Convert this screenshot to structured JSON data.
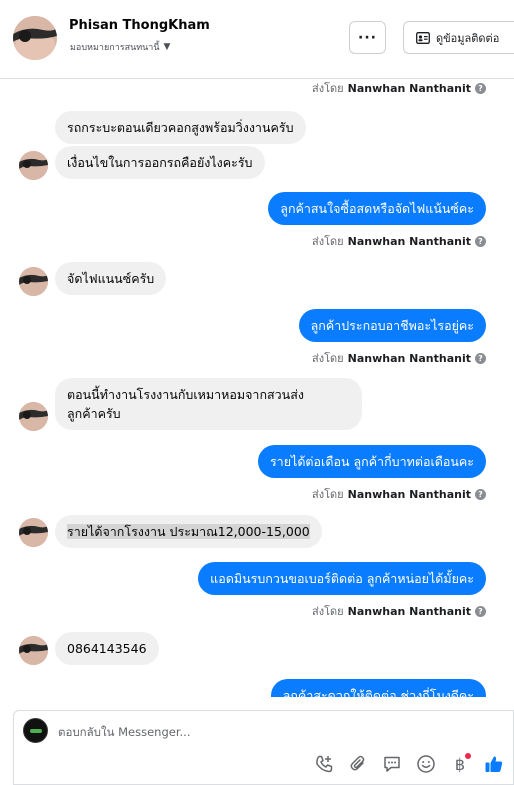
{
  "header": {
    "name": "Phisan ThongKham",
    "assign_label": "มอบหมายการสนทนานี้",
    "more_label": "···",
    "contact_label": "ดูข้อมูลติดต่อ"
  },
  "sent_by": {
    "prefix": "ส่งโดย",
    "author": "Nanwhan Nanthanit",
    "info": "?"
  },
  "messages": [
    "รถกระบะตอนเดียวคอกสูงพร้อมวิ่งงานครับ",
    "เงื่อนไขในการออกรถคือยังไงคะรับ",
    "ลูกค้าสนใจซื้อสดหรือจัดไฟแน้นซ์คะ",
    "จัดไฟแนนซ์ครับ",
    "ลูกค้าประกอบอาชีพอะไรอยู่คะ",
    "ตอนนี้ทำงานโรงงานกับเหมาหอมจากสวนส่ง",
    "ลูกค้าครับ",
    "รายได้ต่อเดือน ลูกค้ากี่บาทต่อเดือนคะ",
    "รายได้จากโรงงาน ประมาณ12,000-15,000",
    "แอดมินรบกวนขอเบอร์ติดต่อ ลูกค้าหน่อยได้มั้ยคะ",
    "0864143546",
    "ลูกค้าสะดวกให้ติดต่อ ช่วงกี่โมงดีคะ"
  ],
  "composer": {
    "placeholder": "ตอบกลับใน Messenger..."
  },
  "icons": [
    "more-icon",
    "contact-card-icon",
    "add-call-icon",
    "attach-icon",
    "saved-reply-icon",
    "emoji-icon",
    "baht-icon",
    "thumbs-up-icon"
  ],
  "colors": {
    "outgoing": "#0a7cff",
    "incoming": "#f0f0f0",
    "like": "#0a7cff"
  }
}
